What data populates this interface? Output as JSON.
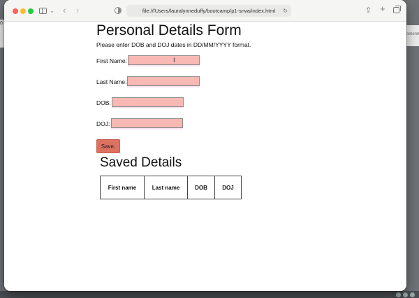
{
  "browser": {
    "url": "file:///Users/lauralynneduffy/bootcamp/p1-snva/index.html"
  },
  "background": {
    "right_peek_text": "omentr",
    "left_peek_text": "0"
  },
  "page": {
    "title": "Personal Details Form",
    "instructions": "Please enter DOB and DOJ dates in DD/MM/YYYY format.",
    "fields": [
      {
        "label": "First Name:",
        "value": ""
      },
      {
        "label": "Last Name:",
        "value": ""
      },
      {
        "label": "DOB:",
        "value": ""
      },
      {
        "label": "DOJ:",
        "value": ""
      }
    ],
    "save_label": "Save.",
    "saved_title": "Saved Details",
    "table_headers": [
      "First name",
      "Last name",
      "DOB",
      "DOJ"
    ]
  },
  "colors": {
    "input_bg": "#f8b8b3",
    "button_bg": "#dd7261"
  },
  "icons": {
    "mouse_cursor": "text-cursor-icon"
  }
}
